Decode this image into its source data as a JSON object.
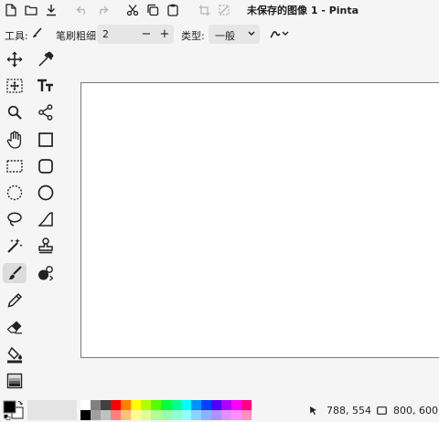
{
  "window": {
    "title": "未保存的图像 1 - Pinta"
  },
  "toolbar": {
    "tool_label": "工具:",
    "brush_width_label": "笔刷粗细:",
    "brush_width_value": "2",
    "minus": "−",
    "plus": "+",
    "type_label": "类型:",
    "type_value": "一般"
  },
  "tools": [
    "move-selected",
    "color-picker",
    "move-selection",
    "text",
    "zoom",
    "line-curve",
    "pan",
    "rectangle",
    "rectangle-select",
    "rounded-rectangle",
    "ellipse-select",
    "ellipse",
    "lasso-select",
    "freeform-shape",
    "magic-wand",
    "clone-stamp",
    "paintbrush",
    "recolor",
    "pencil",
    "eraser",
    "paint-bucket",
    "gradient"
  ],
  "palette": {
    "top_row": [
      "#ffffff",
      "#808080",
      "#404040",
      "#ff0000",
      "#ff8000",
      "#ffff00",
      "#b0ff00",
      "#55ff00",
      "#00ff40",
      "#00ff90",
      "#00ffff",
      "#0090ff",
      "#0040ff",
      "#5000ff",
      "#b000ff",
      "#ff00ff",
      "#ff0080"
    ],
    "bottom_row": [
      "#000000",
      "#a0a0a0",
      "#c0c0c0",
      "#ff8080",
      "#ffc080",
      "#ffff90",
      "#e0ff90",
      "#b0ff90",
      "#90ffb0",
      "#90ffd0",
      "#90ffff",
      "#90d0ff",
      "#90b0ff",
      "#b090ff",
      "#e090ff",
      "#ff90ff",
      "#ff90c0"
    ]
  },
  "status": {
    "cursor": "788, 554",
    "image_size": "800, 600"
  }
}
